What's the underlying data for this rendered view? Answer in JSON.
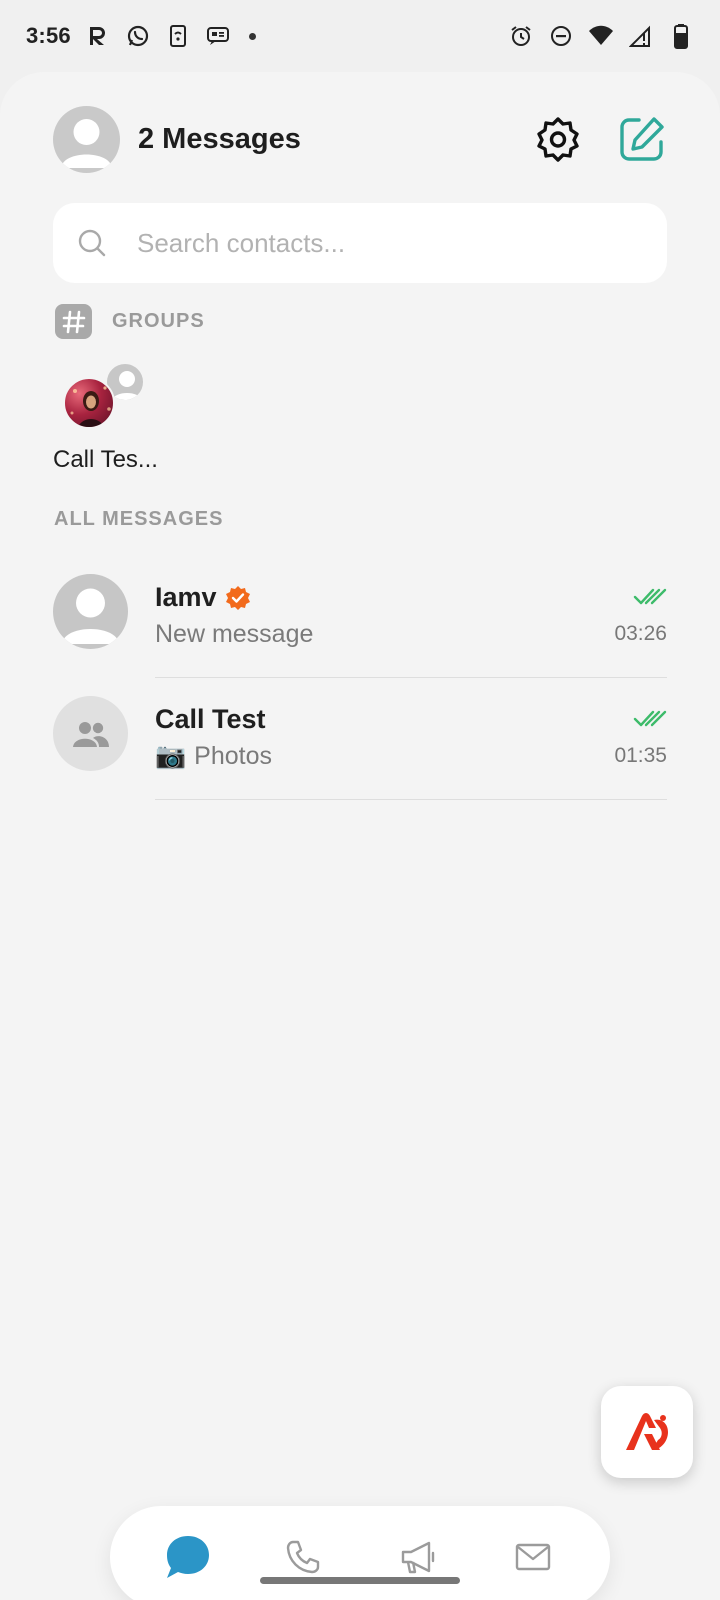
{
  "status_bar": {
    "time": "3:56",
    "left_icons": [
      "r-app-icon",
      "whatsapp-icon",
      "phone-link-icon",
      "message-box-icon",
      "dot-icon"
    ],
    "right_icons": [
      "alarm-icon",
      "do-not-disturb-icon",
      "wifi-icon",
      "signal-icon",
      "battery-icon"
    ]
  },
  "header": {
    "title": "2 Messages",
    "settings_icon": "gear-icon",
    "compose_icon": "compose-icon",
    "compose_color": "#2fa89a"
  },
  "search": {
    "placeholder": "Search contacts...",
    "value": ""
  },
  "groups": {
    "label": "GROUPS",
    "items": [
      {
        "name": "Call Tes..."
      }
    ]
  },
  "all_messages": {
    "label": "ALL MESSAGES",
    "items": [
      {
        "name": "Iamv",
        "verified": true,
        "preview": "New message",
        "time": "03:26",
        "read": true,
        "avatar": "person-avatar"
      },
      {
        "name": "Call Test",
        "verified": false,
        "preview_icon": "📷",
        "preview": "Photos",
        "time": "01:35",
        "read": true,
        "avatar": "group-avatar"
      }
    ]
  },
  "nav": {
    "items": [
      "chat-icon",
      "phone-icon",
      "megaphone-icon",
      "mail-icon"
    ],
    "active": "chat-icon",
    "active_color": "#2b95c7"
  },
  "colors": {
    "read_check": "#3dbb6a",
    "verified_badge": "#f26a1b",
    "fab_logo": "#e8321c"
  }
}
